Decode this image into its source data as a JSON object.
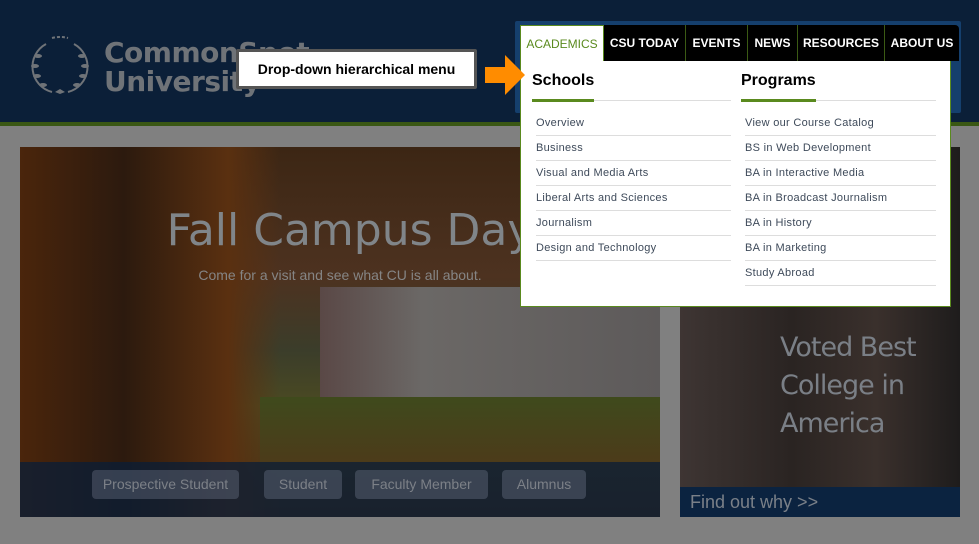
{
  "logo": {
    "line1": "CommonSpot",
    "line2": "University"
  },
  "nav": {
    "tabs": [
      {
        "label": "ACADEMICS",
        "active": true
      },
      {
        "label": "CSU TODAY"
      },
      {
        "label": "EVENTS"
      },
      {
        "label": "NEWS"
      },
      {
        "label": "RESOURCES"
      },
      {
        "label": "ABOUT US"
      }
    ]
  },
  "dropdown": {
    "schools": {
      "heading": "Schools",
      "items": [
        "Overview",
        "Business",
        "Visual and Media Arts",
        "Liberal Arts and Sciences",
        "Journalism",
        "Design and Technology"
      ]
    },
    "programs": {
      "heading": "Programs",
      "items": [
        "View our Course Catalog",
        "BS in Web Development",
        "BA in Interactive Media",
        "BA in Broadcast Journalism",
        "BA in History",
        "BA in Marketing",
        "Study Abroad"
      ]
    }
  },
  "callout": {
    "text": "Drop-down hierarchical menu",
    "arrow_color": "#ff8c00"
  },
  "hero": {
    "title": "Fall Campus Day",
    "subtitle": "Come for a visit and see what CU is all about.",
    "audiences": [
      "Prospective Student",
      "Student",
      "Faculty Member",
      "Alumnus"
    ]
  },
  "side": {
    "lines": [
      "Voted Best",
      "College in",
      "America"
    ],
    "link": "Find out why >>"
  },
  "colors": {
    "header": "#0b1f38",
    "accent_green": "#5a8a1e",
    "overlay": "#808080"
  }
}
